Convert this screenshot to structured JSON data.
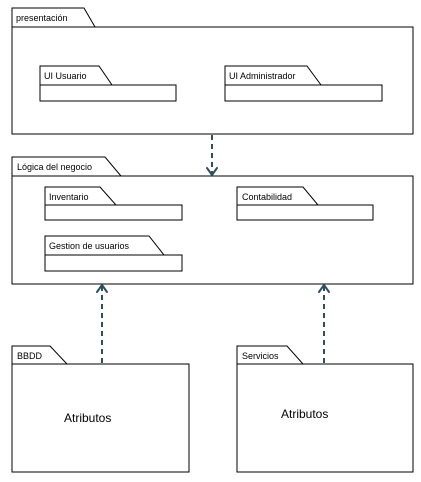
{
  "packages": {
    "presentacion": {
      "label": "presentación"
    },
    "ui_usuario": {
      "label": "UI Usuario"
    },
    "ui_administrador": {
      "label": "UI Administrador"
    },
    "logica": {
      "label": "Lógica del negocio"
    },
    "inventario": {
      "label": "Inventario"
    },
    "contabilidad": {
      "label": "Contabilidad"
    },
    "gestion_usuarios": {
      "label": "Gestion de usuarios"
    },
    "bbdd": {
      "label": "BBDD",
      "body": "Atributos"
    },
    "servicios": {
      "label": "Servicios",
      "body": "Atributos"
    }
  },
  "colors": {
    "line": "#000000",
    "dependency": "#2e4f5e",
    "background": "#ffffff"
  }
}
